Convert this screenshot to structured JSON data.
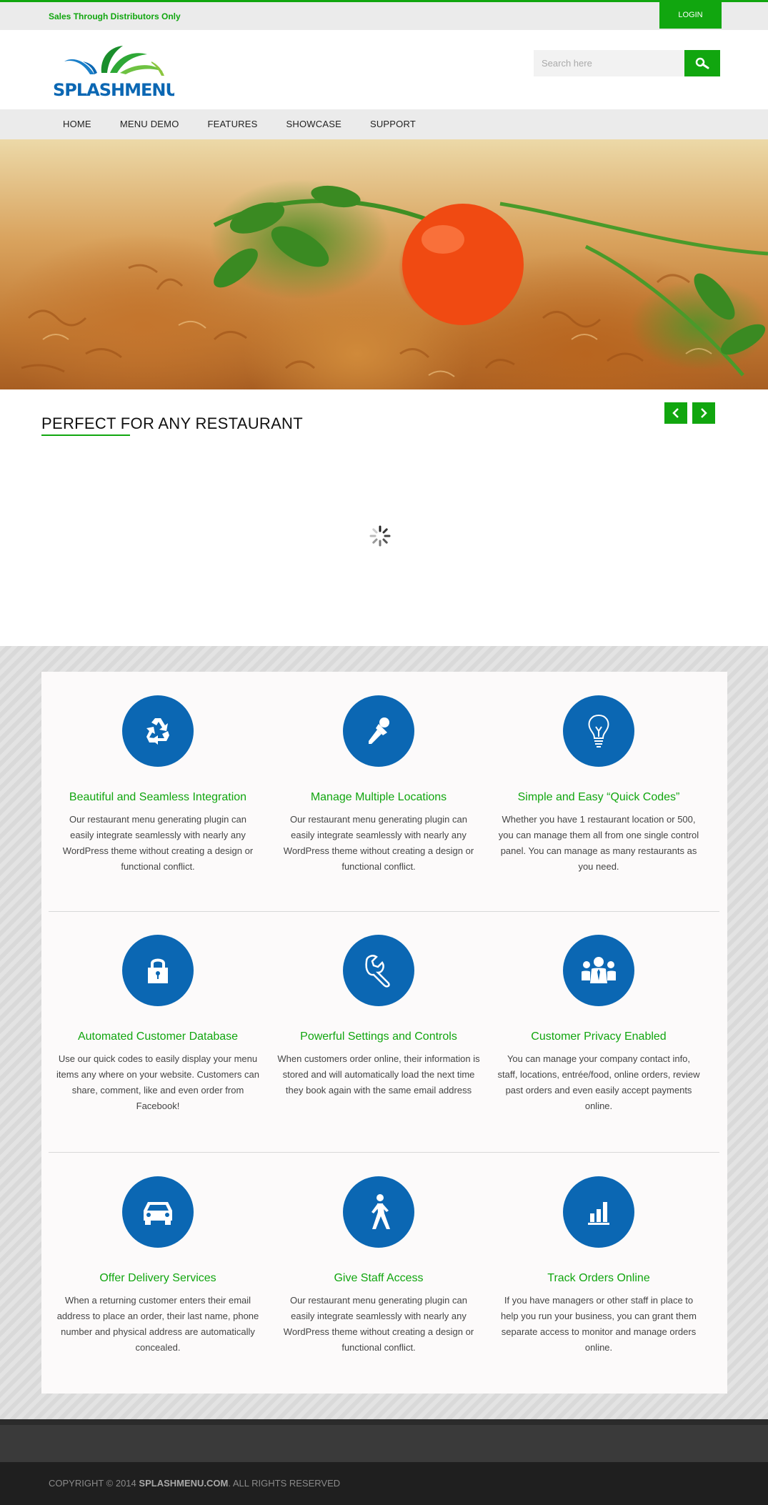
{
  "topbar": {
    "tagline": "Sales Through Distributors Only",
    "login_label": "LOGIN"
  },
  "header": {
    "logo_text": "SPLASHMENU",
    "search_placeholder": "Search here"
  },
  "nav": {
    "items": [
      "HOME",
      "MENU DEMO",
      "FEATURES",
      "SHOWCASE",
      "SUPPORT"
    ]
  },
  "section": {
    "title": "PERFECT FOR ANY RESTAURANT"
  },
  "features": [
    {
      "icon": "recycle-icon",
      "title": "Beautiful and Seamless Integration",
      "desc": "Our restaurant menu generating plugin can easily integrate seamlessly with nearly any WordPress theme without creating a design or functional conflict."
    },
    {
      "icon": "pushpin-icon",
      "title": "Manage Multiple Locations",
      "desc": "Our restaurant menu generating plugin can easily integrate seamlessly with nearly any WordPress theme without creating a design or functional conflict."
    },
    {
      "icon": "lightbulb-icon",
      "title": "Simple and Easy “Quick Codes”",
      "desc": "Whether you have 1 restaurant location or 500, you can manage them all from one single control panel. You can manage as many restaurants as you need."
    },
    {
      "icon": "lock-icon",
      "title": "Automated Customer Database",
      "desc": "Use our quick codes to easily display your menu items any where on your website. Customers can share, comment, like and even order from Facebook!"
    },
    {
      "icon": "wrench-icon",
      "title": "Powerful Settings and Controls",
      "desc": "When customers order online, their information is stored and will automatically load the next time they book again with the same email address"
    },
    {
      "icon": "people-icon",
      "title": "Customer Privacy Enabled",
      "desc": "You can manage your company contact info, staff, locations, entrée/food, online orders, review past orders and even easily accept payments online."
    },
    {
      "icon": "car-icon",
      "title": "Offer Delivery Services",
      "desc": "When a returning customer enters their email address to place an order, their last name, phone number and physical address are automatically concealed."
    },
    {
      "icon": "walking-person-icon",
      "title": "Give Staff Access",
      "desc": "Our restaurant menu generating plugin can easily integrate seamlessly with nearly any WordPress theme without creating a design or functional conflict."
    },
    {
      "icon": "bar-chart-icon",
      "title": "Track Orders Online",
      "desc": "If you have managers or other staff in place to help you run your business, you can grant them separate access to monitor and manage orders online."
    }
  ],
  "footer": {
    "copyright_prefix": "COPYRIGHT © 2014",
    "site": "SPLASHMENU.COM",
    "suffix": ". ALL RIGHTS RESERVED"
  },
  "colors": {
    "accent": "#11a60f",
    "icon_circle": "#0b67b3"
  }
}
